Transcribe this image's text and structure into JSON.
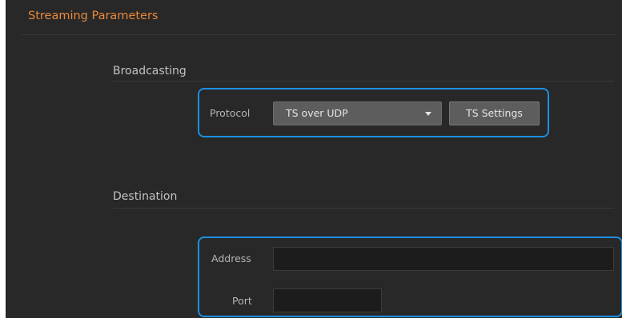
{
  "panel": {
    "title": "Streaming Parameters"
  },
  "broadcasting": {
    "heading": "Broadcasting",
    "protocol_label": "Protocol",
    "protocol_value": "TS over UDP",
    "ts_settings_label": "TS Settings"
  },
  "destination": {
    "heading": "Destination",
    "address_label": "Address",
    "address_value": "",
    "port_label": "Port",
    "port_value": ""
  },
  "colors": {
    "panel_background": "#282828",
    "title_accent": "#e8883a",
    "highlight_outline": "#1c8fe0"
  }
}
